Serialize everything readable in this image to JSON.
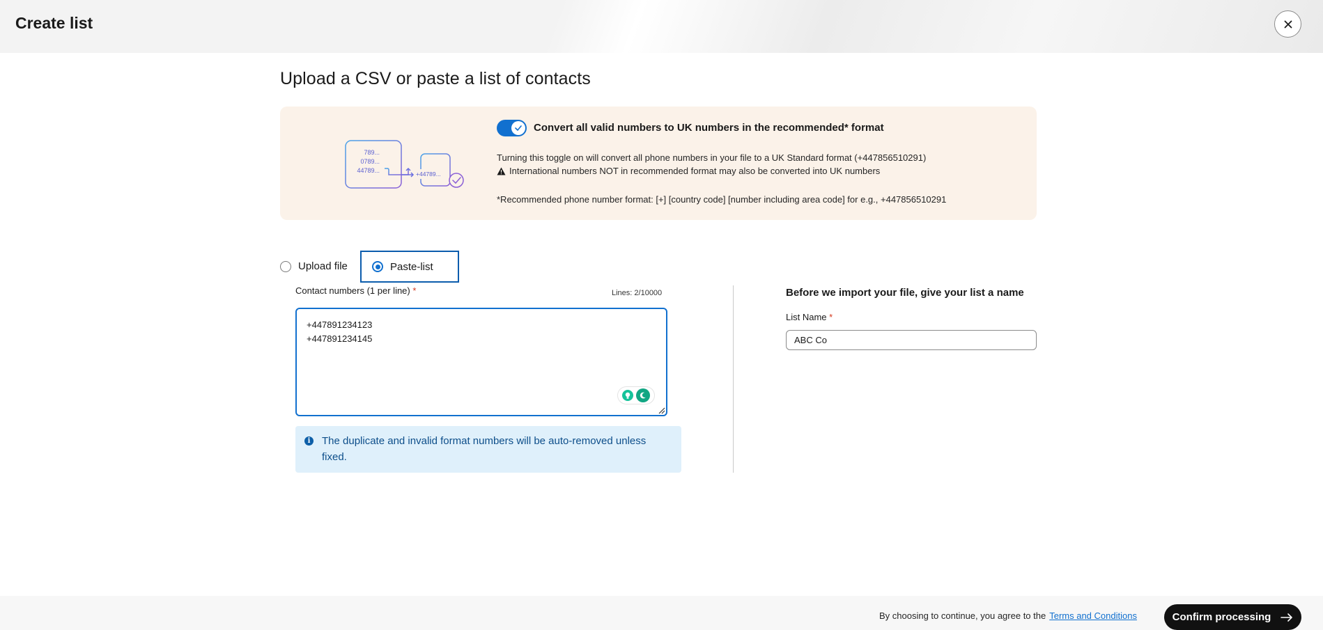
{
  "header": {
    "title": "Create list",
    "close_icon": "close-icon"
  },
  "page": {
    "title": "Upload a CSV or paste a list of contacts"
  },
  "banner": {
    "toggle_on": true,
    "toggle_label": "Convert all valid numbers to UK numbers in the recommended* format",
    "line1": "Turning this toggle on will convert all phone numbers in your file to a UK Standard format (+447856510291)",
    "line2": "International numbers NOT in recommended format may also be converted into UK numbers",
    "line3": "*Recommended phone number format: [+] [country code] [number including area code] for e.g., +447856510291",
    "illustration": {
      "samples": [
        "789...",
        "0789...",
        "44789..."
      ],
      "result": "+44789..."
    },
    "accent_color": "#1170cf",
    "background_color": "#fbf2e9"
  },
  "source": {
    "options": [
      {
        "label": "Upload file",
        "selected": false
      },
      {
        "label": "Paste-list",
        "selected": true
      }
    ]
  },
  "contacts": {
    "label": "Contact numbers (1 per line)",
    "required_mark": "*",
    "lines_count": "Lines: 2/10000",
    "value": "+447891234123\n+447891234145"
  },
  "alert": {
    "text": "The duplicate and invalid format numbers will be auto-removed unless fixed.",
    "icon": "info-icon"
  },
  "list_name": {
    "heading": "Before we import your file, give your list a name",
    "label": "List Name",
    "required_mark": "*",
    "value": "ABC Co"
  },
  "footer": {
    "terms_prefix": "By choosing to continue, you agree to the",
    "terms_link": "Terms and Conditions",
    "confirm_label": "Confirm processing",
    "confirm_icon": "arrow-right-icon"
  }
}
